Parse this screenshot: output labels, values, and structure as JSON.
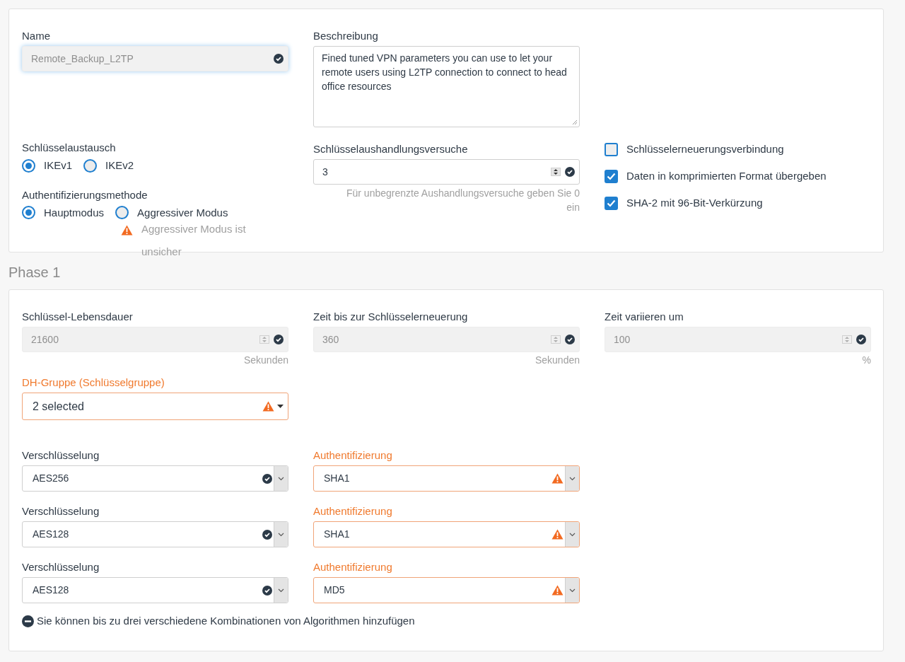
{
  "general": {
    "name": {
      "label": "Name",
      "value": "Remote_Backup_L2TP",
      "disabled": true,
      "warning": false
    },
    "description": {
      "label": "Beschreibung",
      "value": "Fined tuned VPN parameters you can use to let your remote users using L2TP connection to connect to head office resources"
    },
    "key_exchange": {
      "label": "Schlüsselaustausch",
      "options": [
        {
          "label": "IKEv1",
          "selected": true
        },
        {
          "label": "IKEv2",
          "selected": false
        }
      ]
    },
    "auth_method": {
      "label": "Authentifizierungsmethode",
      "options": [
        {
          "label": "Hauptmodus",
          "selected": true
        },
        {
          "label": "Aggressiver Modus",
          "selected": false
        }
      ],
      "warning": "Aggressiver Modus ist unsicher"
    },
    "negotiation_tries": {
      "label": "Schlüsselaushandlungsversuche",
      "value": "3",
      "disabled": false,
      "warning": false,
      "hint": "Für unbegrenzte Aushandlungsversuche geben Sie 0 ein"
    },
    "checkboxes": [
      {
        "label": "Schlüsselerneuerungsverbindung",
        "checked": false
      },
      {
        "label": "Daten in komprimierten Format übergeben",
        "checked": true
      },
      {
        "label": "SHA-2 mit 96-Bit-Verkürzung",
        "checked": true
      }
    ]
  },
  "phase1": {
    "title": "Phase 1",
    "fields": [
      {
        "label": "Schlüssel-Lebensdauer",
        "value": "21600",
        "unit": "Sekunden",
        "disabled": true,
        "warning": false
      },
      {
        "label": "Zeit bis zur Schlüsselerneuerung",
        "value": "360",
        "unit": "Sekunden",
        "disabled": true,
        "warning": false
      },
      {
        "label": "Zeit variieren um",
        "value": "100",
        "unit": "%",
        "disabled": true,
        "warning": false
      }
    ],
    "dh_group": {
      "label": "DH-Gruppe (Schlüsselgruppe)",
      "value": "2 selected",
      "warning": true
    },
    "algorithms": [
      {
        "encryption": {
          "label": "Verschlüsselung",
          "value": "AES256",
          "warning": false
        },
        "authentication": {
          "label": "Authentifizierung",
          "value": "SHA1",
          "warning": true
        }
      },
      {
        "encryption": {
          "label": "Verschlüsselung",
          "value": "AES128",
          "warning": false
        },
        "authentication": {
          "label": "Authentifizierung",
          "value": "SHA1",
          "warning": true
        }
      },
      {
        "encryption": {
          "label": "Verschlüsselung",
          "value": "AES128",
          "warning": false
        },
        "authentication": {
          "label": "Authentifizierung",
          "value": "MD5",
          "warning": true
        }
      }
    ],
    "note": "Sie können bis zu drei verschiedene Kombinationen von Algorithmen hinzufügen"
  }
}
